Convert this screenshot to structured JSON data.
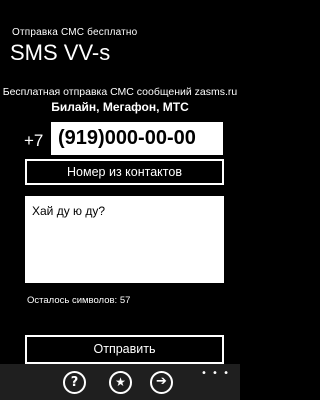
{
  "header": {
    "app_title": "Отправка СМС бесплатно",
    "page_title": "SMS VV-s"
  },
  "main": {
    "subtitle": "Бесплатная отправка СМС сообщений zasms.ru",
    "operators": "Билайн, Мегафон, МТС",
    "phone_prefix": "+7",
    "phone_value": "(919)000-00-00",
    "contacts_button": "Номер из контактов",
    "message_value": "Хай ду ю ду?",
    "remaining_label": "Осталось символов:",
    "remaining_count": "57",
    "send_button": "Отправить"
  },
  "app_bar": {
    "help_icon": "help-icon",
    "favorite_icon": "star-icon",
    "go_icon": "arrow-right-icon",
    "more_icon": "ellipsis-icon"
  }
}
